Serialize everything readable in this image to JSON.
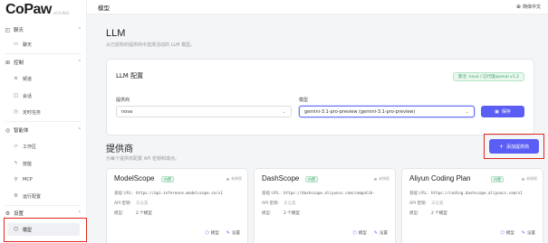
{
  "app": {
    "logo": "CoPaw",
    "version": "v0.0.6b1"
  },
  "topbar": {
    "breadcrumb": "模型",
    "language": "简体中文"
  },
  "sidebar": {
    "groups": [
      {
        "label": "聊天",
        "icon": "chat-icon",
        "items": [
          {
            "label": "聊天",
            "icon": "chat-bubble-icon"
          }
        ]
      },
      {
        "label": "控制",
        "icon": "control-icon",
        "items": [
          {
            "label": "频道",
            "icon": "wifi-icon"
          },
          {
            "label": "会话",
            "icon": "session-icon"
          },
          {
            "label": "定时任务",
            "icon": "clock-icon"
          }
        ]
      },
      {
        "label": "智能体",
        "icon": "agent-icon",
        "items": [
          {
            "label": "工作区",
            "icon": "folder-icon"
          },
          {
            "label": "技能",
            "icon": "bolt-icon"
          },
          {
            "label": "MCP",
            "icon": "plug-icon"
          },
          {
            "label": "运行配置",
            "icon": "gear-icon"
          }
        ]
      },
      {
        "label": "设置",
        "icon": "settings-icon",
        "items": [
          {
            "label": "模型",
            "icon": "cube-icon",
            "active": true
          }
        ]
      }
    ]
  },
  "main": {
    "title": "LLM",
    "desc": "从已授权的提供商中选择活动的 LLM 模型。",
    "llm_card": {
      "title": "LLM 配置",
      "badge": "激活: nova / 已代理openai v1.2",
      "provider_label": "提供商",
      "provider_value": "nova",
      "model_label": "模型",
      "model_value": "gemini-3.1-pro-preview (gemini-3.1-pro-preview)",
      "save_label": "保存"
    },
    "providers": {
      "title": "提供商",
      "desc": "为每个提供商配置 API 密钥和端点。",
      "add_label": "添加提供商",
      "cards": [
        {
          "name": "ModelScope",
          "tag": "内置",
          "status": "未授权",
          "base_url_label": "基础 URL:",
          "base_url": "https://api-inference.modelscope.cn/v1",
          "api_key_label": "API 密钥:",
          "api_key": "未设置",
          "models_label": "模型:",
          "models": "2 个模型",
          "models_action": "模型",
          "settings_action": "设置"
        },
        {
          "name": "DashScope",
          "tag": "内置",
          "status": "未授权",
          "base_url_label": "基础 URL:",
          "base_url": "https://dashscope.aliyuncs.com/compatib-",
          "api_key_label": "API 密钥:",
          "api_key": "未设置",
          "models_label": "模型:",
          "models": "2 个模型",
          "models_action": "模型",
          "settings_action": "设置"
        },
        {
          "name": "Aliyun Coding Plan",
          "tag": "内置",
          "status": "未授权",
          "base_url_label": "基础 URL:",
          "base_url": "https://coding.dashscope.aliyuncs.com/v1",
          "api_key_label": "API 密钥:",
          "api_key": "未设置",
          "models_label": "模型:",
          "models": "2 个模型",
          "models_action": "模型",
          "settings_action": "设置"
        }
      ]
    }
  },
  "colors": {
    "accent": "#5b5ef4",
    "highlight": "#e0261f",
    "success": "#3aa66a"
  }
}
